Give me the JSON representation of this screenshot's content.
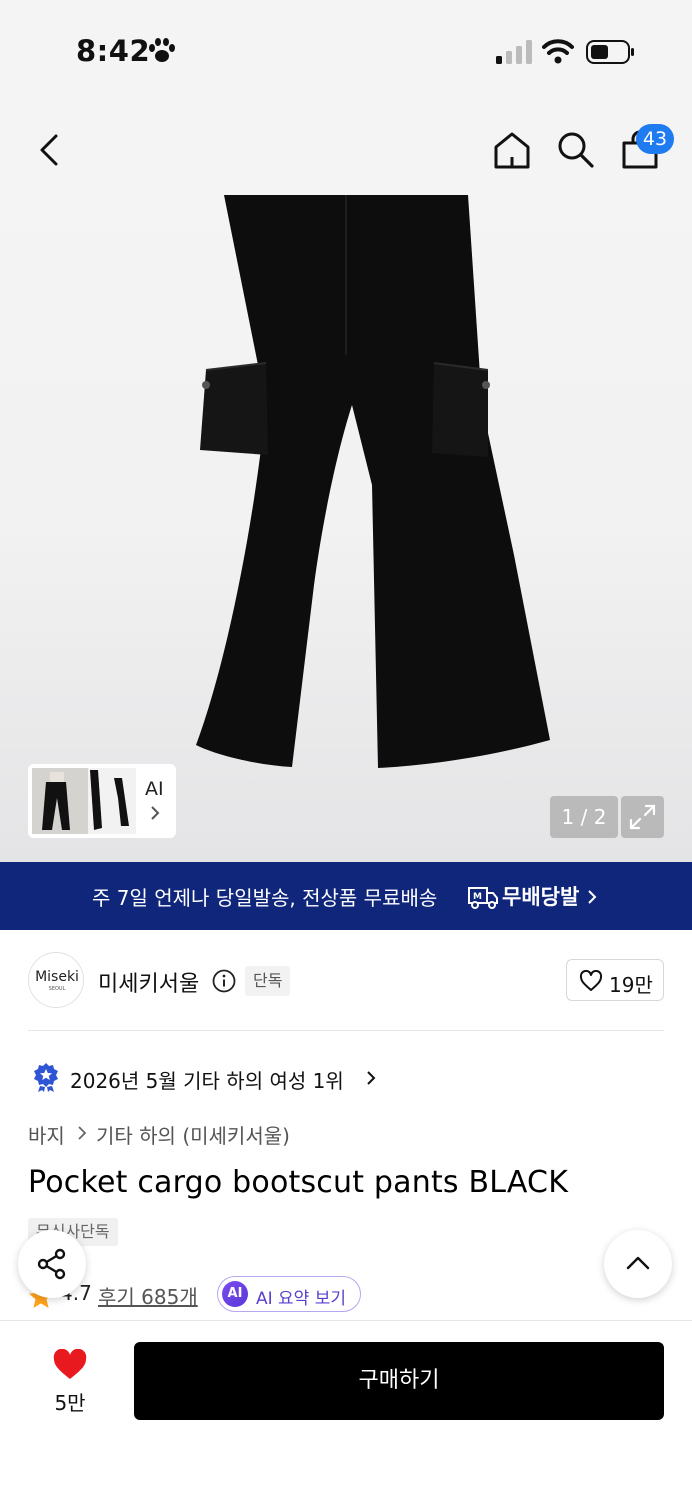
{
  "status_bar": {
    "time": "8:42"
  },
  "header": {
    "cart_count": "43"
  },
  "gallery": {
    "thumb_label": "AI",
    "page_indicator": "1 / 2"
  },
  "banner": {
    "text": "주 7일 언제나 당일발송, 전상품 무료배송",
    "strong": "무배당발"
  },
  "brand": {
    "logo_text": "Miseki",
    "logo_sub": "SEOUL",
    "name": "미세키서울",
    "tag": "단독",
    "likes": "19만"
  },
  "ranking": {
    "text": "2026년 5월 기타 하의 여성 1위"
  },
  "breadcrumb": {
    "level1": "바지",
    "level2": "기타 하의 (미세키서울)"
  },
  "product": {
    "title": "Pocket cargo bootscut pants BLACK",
    "tag": "무신사단독",
    "rating": "4.7",
    "reviews": "후기 685개",
    "ai_badge": "AI",
    "ai_summary": "AI 요약 보기"
  },
  "bottom": {
    "like_count": "5만",
    "buy_label": "구매하기"
  },
  "colors": {
    "banner_bg": "#10267b",
    "badge_blue": "#1e7bf0",
    "heart_red": "#e8191f",
    "buy_bg": "#000000"
  }
}
